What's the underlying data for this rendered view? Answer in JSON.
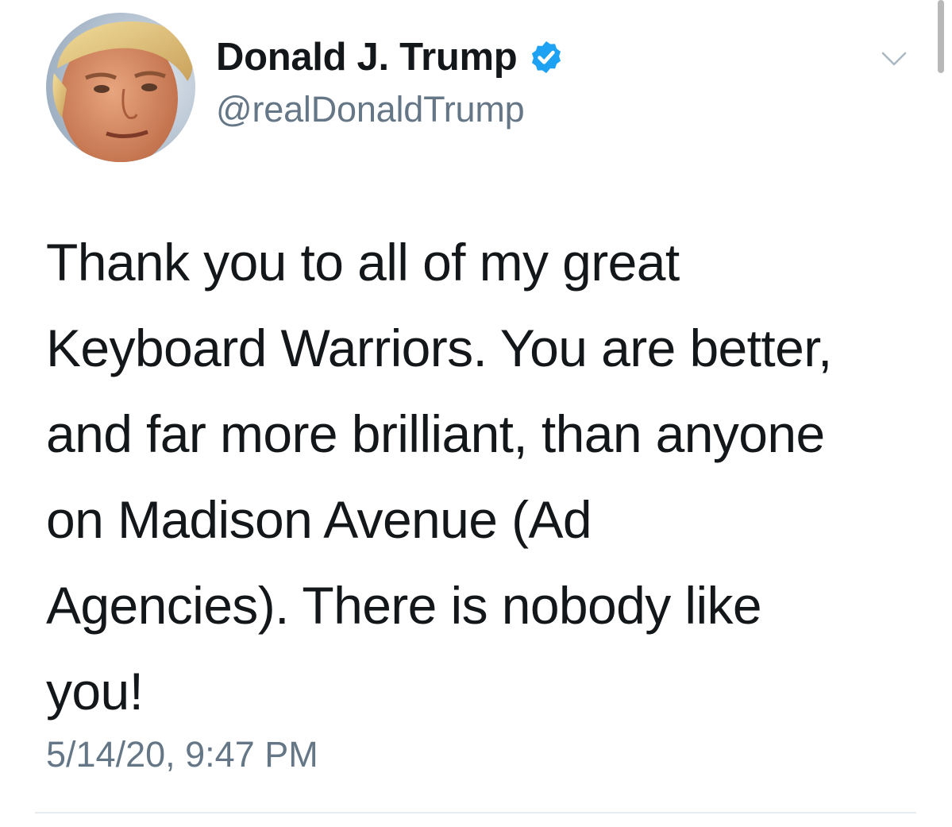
{
  "tweet": {
    "author": {
      "display_name": "Donald J. Trump",
      "handle": "@realDonaldTrump",
      "verified": true,
      "avatar_icon": "profile-photo"
    },
    "menu_icon": "chevron-down-icon",
    "text": "Thank you to all of my great\nKeyboard Warriors. You are better,\nand far more brilliant, than anyone\non Madison Avenue (Ad\nAgencies). There is nobody like\nyou!",
    "timestamp": "5/14/20, 9:47 PM"
  },
  "colors": {
    "text_primary": "#14171a",
    "text_secondary": "#657786",
    "verified_blue": "#1da1f2",
    "divider": "#e6ecf0",
    "background": "#ffffff"
  }
}
